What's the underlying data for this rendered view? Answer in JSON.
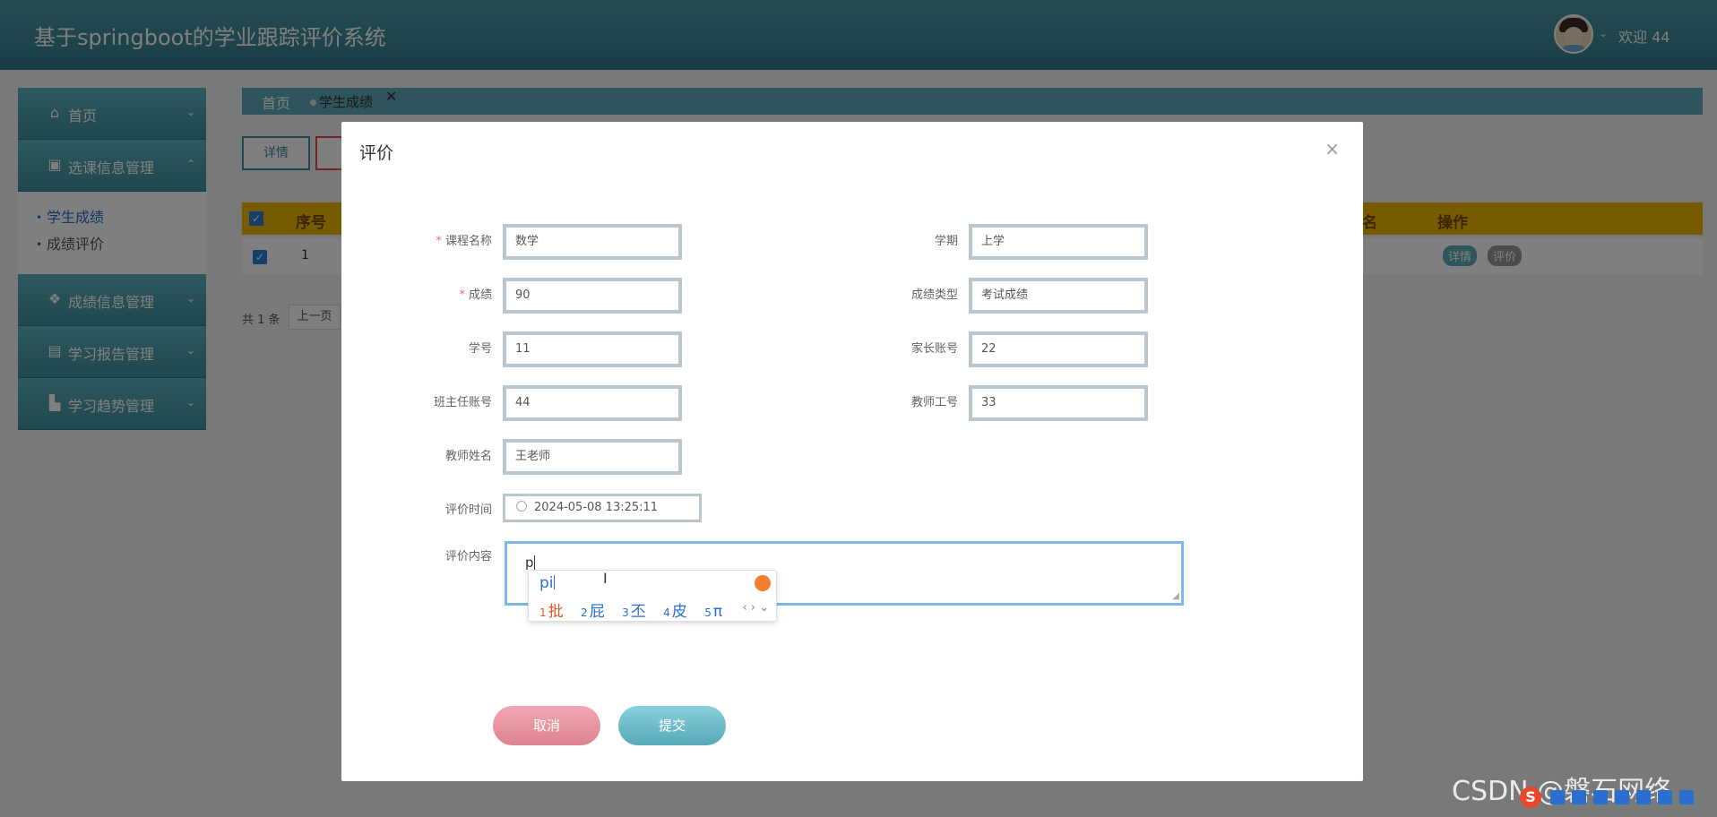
{
  "app": {
    "title": "基于springboot的学业跟踪评价系统",
    "welcome": "欢迎 44"
  },
  "sidebar": {
    "items": [
      {
        "label": "首页",
        "icon": "home-icon"
      },
      {
        "label": "选课信息管理",
        "icon": "card-icon"
      },
      {
        "label": "成绩信息管理",
        "icon": "grid-icon"
      },
      {
        "label": "学习报告管理",
        "icon": "layout-icon"
      },
      {
        "label": "学习趋势管理",
        "icon": "chart-icon"
      }
    ],
    "sub_items": [
      {
        "label": "学生成绩",
        "active": true
      },
      {
        "label": "成绩评价",
        "active": false
      }
    ]
  },
  "tabs": {
    "home": "首页",
    "active": "学生成绩",
    "close": "✕"
  },
  "toolbar": {
    "detail": "详情"
  },
  "table": {
    "headers": {
      "index": "序号",
      "name_partial": "名",
      "actions": "操作"
    },
    "row": {
      "index": "1",
      "op_detail": "详情",
      "op_review": "评价"
    },
    "total": "共 1 条",
    "prev": "上一页"
  },
  "dialog": {
    "title": "评价",
    "close": "×",
    "fields": {
      "course_name": {
        "label": "课程名称",
        "value": "数学",
        "required": true
      },
      "semester": {
        "label": "学期",
        "value": "上学"
      },
      "score": {
        "label": "成绩",
        "value": "90",
        "required": true
      },
      "score_type": {
        "label": "成绩类型",
        "value": "考试成绩"
      },
      "student_no": {
        "label": "学号",
        "value": "11"
      },
      "parent_account": {
        "label": "家长账号",
        "value": "22"
      },
      "head_teacher_account": {
        "label": "班主任账号",
        "value": "44"
      },
      "teacher_no": {
        "label": "教师工号",
        "value": "33"
      },
      "teacher_name": {
        "label": "教师姓名",
        "value": "王老师"
      },
      "review_time": {
        "label": "评价时间",
        "value": "2024-05-08 13:25:11"
      },
      "review_content": {
        "label": "评价内容",
        "value": "p"
      }
    },
    "required_mark": "*",
    "cancel": "取消",
    "submit": "提交"
  },
  "ime": {
    "pinyin": "pi",
    "candidates": [
      {
        "n": "1",
        "text": "批"
      },
      {
        "n": "2",
        "text": "屁"
      },
      {
        "n": "3",
        "text": "丕"
      },
      {
        "n": "4",
        "text": "皮"
      },
      {
        "n": "5",
        "text": "π"
      }
    ],
    "nav": "‹ › ⌄"
  },
  "watermark": "CSDN @磐石网络"
}
